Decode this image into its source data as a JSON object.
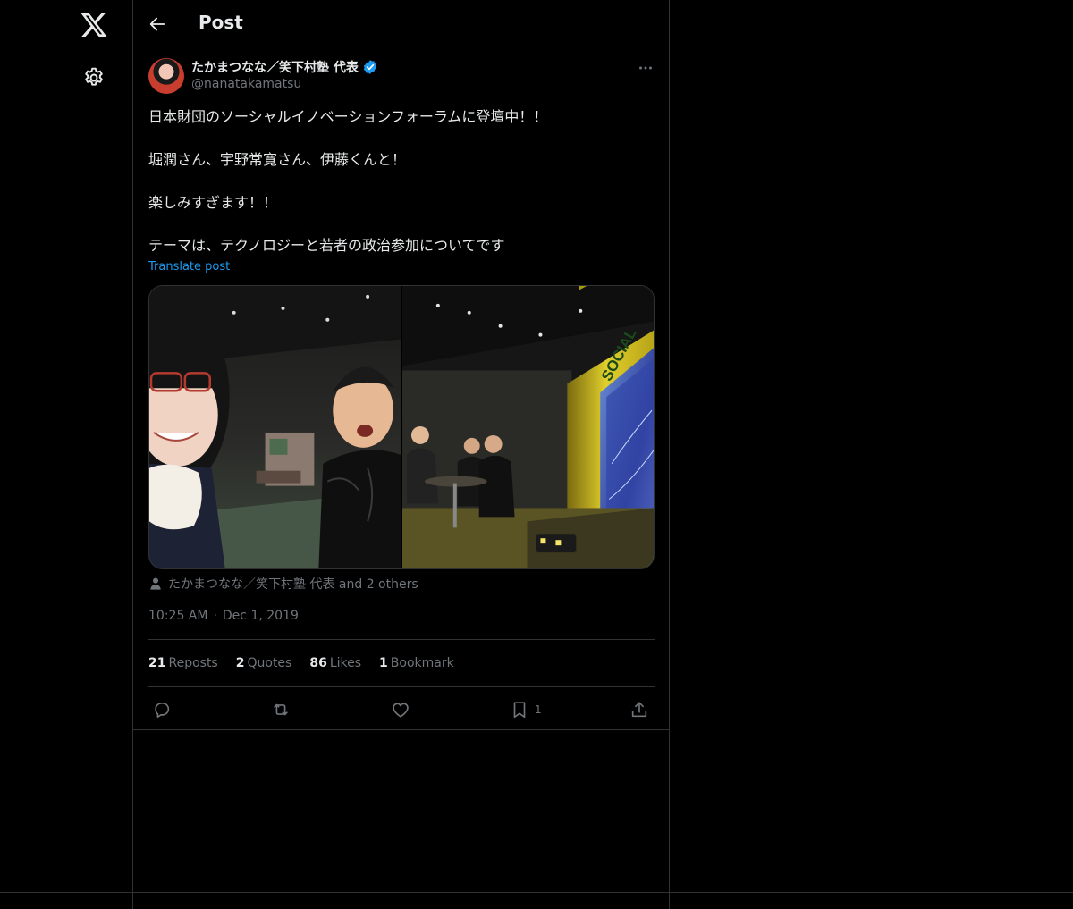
{
  "header": {
    "title": "Post"
  },
  "post": {
    "author_name": "たかまつなな／笑下村塾 代表",
    "handle": "@nanatakamatsu",
    "text_lines": [
      "日本財団のソーシャルイノベーションフォーラムに登壇中！！",
      "堀潤さん、宇野常寛さん、伊藤くんと！",
      "楽しみすぎます！！",
      "テーマは、テクノロジーと若者の政治参加についてです"
    ],
    "translate_label": "Translate post",
    "tagged": "たかまつなな／笑下村塾 代表 and 2 others",
    "time": "10:25 AM",
    "date": "Dec 1, 2019",
    "stage_sign": "SOCIAL"
  },
  "stats": {
    "reposts_count": "21",
    "reposts_label": "Reposts",
    "quotes_count": "2",
    "quotes_label": "Quotes",
    "likes_count": "86",
    "likes_label": "Likes",
    "bookmarks_count": "1",
    "bookmarks_label": "Bookmark"
  },
  "actions": {
    "bookmark_count": "1"
  },
  "icons": [
    "x-logo-icon",
    "gear-icon",
    "back-arrow-icon",
    "verified-badge-icon",
    "more-icon",
    "person-icon",
    "reply-icon",
    "repost-icon",
    "like-icon",
    "bookmark-icon",
    "share-icon"
  ],
  "colors": {
    "background": "#000000",
    "text": "#e7e9ea",
    "muted": "#71767b",
    "accent": "#1d9bf0",
    "border": "#2f3336"
  }
}
